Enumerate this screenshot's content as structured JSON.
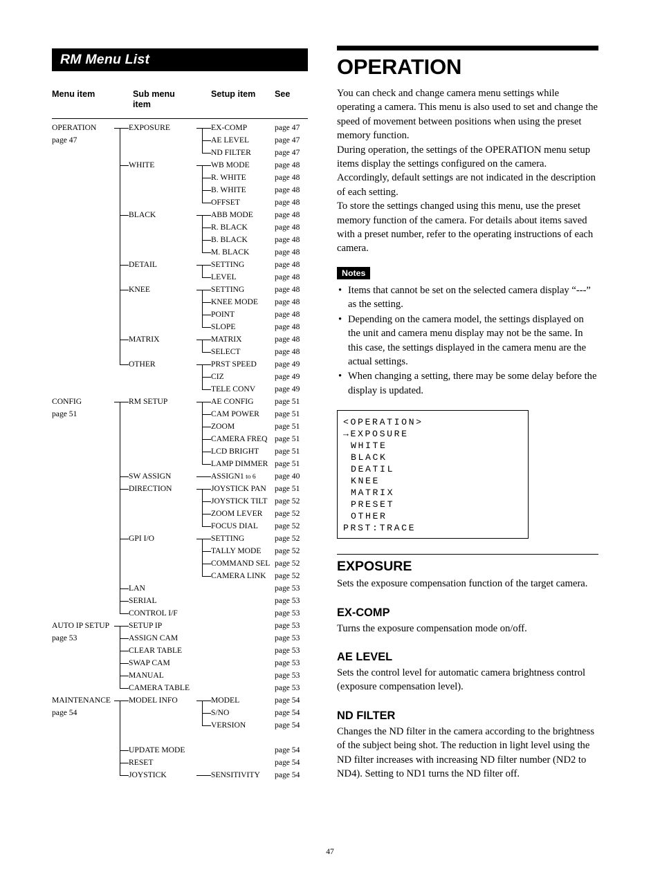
{
  "left": {
    "title": "RM Menu List",
    "columns": [
      "Menu item",
      "Sub menu item",
      "Setup item",
      "See"
    ],
    "column_headers": {
      "menu_item": "Menu item",
      "sub_menu_item_line1": "Sub menu",
      "sub_menu_item_line2": "item",
      "setup_item": "Setup item",
      "see": "See"
    },
    "rows": [
      {
        "l0": "OPERATION",
        "l1": "EXPOSURE",
        "l2": "EX-COMP",
        "see": "page 47",
        "l1conn": "top",
        "l2conn": "top"
      },
      {
        "l0": "page 47",
        "l1": "",
        "l2": "AE LEVEL",
        "see": "page 47",
        "l1conn": "mid",
        "l2conn": "mid"
      },
      {
        "l0": "",
        "l1": "",
        "l2": "ND FILTER",
        "see": "page 47",
        "l1conn": "mid",
        "l2conn": "end"
      },
      {
        "l0": "",
        "l1": "WHITE",
        "l2": "WB MODE",
        "see": "page 48",
        "l1conn": "tee",
        "l2conn": "top"
      },
      {
        "l0": "",
        "l1": "",
        "l2": "R. WHITE",
        "see": "page 48",
        "l1conn": "mid",
        "l2conn": "mid"
      },
      {
        "l0": "",
        "l1": "",
        "l2": "B. WHITE",
        "see": "page 48",
        "l1conn": "mid",
        "l2conn": "mid"
      },
      {
        "l0": "",
        "l1": "",
        "l2": "OFFSET",
        "see": "page 48",
        "l1conn": "mid",
        "l2conn": "end"
      },
      {
        "l0": "",
        "l1": "BLACK",
        "l2": "ABB MODE",
        "see": "page 48",
        "l1conn": "tee",
        "l2conn": "top"
      },
      {
        "l0": "",
        "l1": "",
        "l2": "R. BLACK",
        "see": "page 48",
        "l1conn": "mid",
        "l2conn": "mid"
      },
      {
        "l0": "",
        "l1": "",
        "l2": "B. BLACK",
        "see": "page 48",
        "l1conn": "mid",
        "l2conn": "mid"
      },
      {
        "l0": "",
        "l1": "",
        "l2": "M. BLACK",
        "see": "page 48",
        "l1conn": "mid",
        "l2conn": "end"
      },
      {
        "l0": "",
        "l1": "DETAIL",
        "l2": "SETTING",
        "see": "page 48",
        "l1conn": "tee",
        "l2conn": "top"
      },
      {
        "l0": "",
        "l1": "",
        "l2": "LEVEL",
        "see": "page 48",
        "l1conn": "mid",
        "l2conn": "end"
      },
      {
        "l0": "",
        "l1": "KNEE",
        "l2": "SETTING",
        "see": "page 48",
        "l1conn": "tee",
        "l2conn": "top"
      },
      {
        "l0": "",
        "l1": "",
        "l2": "KNEE MODE",
        "see": "page 48",
        "l1conn": "mid",
        "l2conn": "mid"
      },
      {
        "l0": "",
        "l1": "",
        "l2": "POINT",
        "see": "page 48",
        "l1conn": "mid",
        "l2conn": "mid"
      },
      {
        "l0": "",
        "l1": "",
        "l2": "SLOPE",
        "see": "page 48",
        "l1conn": "mid",
        "l2conn": "end"
      },
      {
        "l0": "",
        "l1": "MATRIX",
        "l2": "MATRIX",
        "see": "page 48",
        "l1conn": "tee",
        "l2conn": "top"
      },
      {
        "l0": "",
        "l1": "",
        "l2": "SELECT",
        "see": "page 48",
        "l1conn": "mid",
        "l2conn": "end"
      },
      {
        "l0": "",
        "l1": "OTHER",
        "l2": "PRST SPEED",
        "see": "page 49",
        "l1conn": "endtee",
        "l2conn": "top"
      },
      {
        "l0": "",
        "l1": "",
        "l2": "CIZ",
        "see": "page 49",
        "l1conn": "none",
        "l2conn": "mid"
      },
      {
        "l0": "",
        "l1": "",
        "l2": "TELE CONV",
        "see": "page 49",
        "l1conn": "none",
        "l2conn": "end"
      },
      {
        "l0": "CONFIG",
        "l1": "RM SETUP",
        "l2": "AE CONFIG",
        "see": "page 51",
        "l1conn": "top",
        "l2conn": "top"
      },
      {
        "l0": "page 51",
        "l1": "",
        "l2": "CAM POWER",
        "see": "page 51",
        "l1conn": "mid",
        "l2conn": "mid"
      },
      {
        "l0": "",
        "l1": "",
        "l2": "ZOOM",
        "see": "page 51",
        "l1conn": "mid",
        "l2conn": "mid"
      },
      {
        "l0": "",
        "l1": "",
        "l2": "CAMERA FREQ",
        "see": "page 51",
        "l1conn": "mid",
        "l2conn": "mid"
      },
      {
        "l0": "",
        "l1": "",
        "l2": "LCD BRIGHT",
        "see": "page 51",
        "l1conn": "mid",
        "l2conn": "mid"
      },
      {
        "l0": "",
        "l1": "",
        "l2": "LAMP DIMMER",
        "see": "page 51",
        "l1conn": "mid",
        "l2conn": "end"
      },
      {
        "l0": "",
        "l1": "SW ASSIGN",
        "l2": "ASSIGN1 to 6",
        "see": "page 40",
        "l1conn": "tee",
        "l2conn": "flat",
        "l2small": " to 6",
        "l2main": "ASSIGN1"
      },
      {
        "l0": "",
        "l1": "DIRECTION",
        "l2": "JOYSTICK PAN",
        "see": "page 51",
        "l1conn": "tee",
        "l2conn": "top"
      },
      {
        "l0": "",
        "l1": "",
        "l2": "JOYSTICK TILT",
        "see": "page 52",
        "l1conn": "mid",
        "l2conn": "mid"
      },
      {
        "l0": "",
        "l1": "",
        "l2": "ZOOM LEVER",
        "see": "page 52",
        "l1conn": "mid",
        "l2conn": "mid"
      },
      {
        "l0": "",
        "l1": "",
        "l2": "FOCUS DIAL",
        "see": "page 52",
        "l1conn": "mid",
        "l2conn": "end"
      },
      {
        "l0": "",
        "l1": "GPI I/O",
        "l2": "SETTING",
        "see": "page 52",
        "l1conn": "tee",
        "l2conn": "top"
      },
      {
        "l0": "",
        "l1": "",
        "l2": "TALLY MODE",
        "see": "page 52",
        "l1conn": "mid",
        "l2conn": "mid"
      },
      {
        "l0": "",
        "l1": "",
        "l2": "COMMAND SEL",
        "see": "page 52",
        "l1conn": "mid",
        "l2conn": "mid"
      },
      {
        "l0": "",
        "l1": "",
        "l2": "CAMERA LINK",
        "see": "page 52",
        "l1conn": "mid",
        "l2conn": "end"
      },
      {
        "l0": "",
        "l1": "LAN",
        "l2": "",
        "see": "page 53",
        "l1conn": "tee",
        "l2conn": "none"
      },
      {
        "l0": "",
        "l1": "SERIAL",
        "l2": "",
        "see": "page 53",
        "l1conn": "tee",
        "l2conn": "none"
      },
      {
        "l0": "",
        "l1": "CONTROL I/F",
        "l2": "",
        "see": "page 53",
        "l1conn": "endtee",
        "l2conn": "none"
      },
      {
        "l0": "AUTO IP SETUP",
        "l1": "SETUP IP",
        "l2": "",
        "see": "page 53",
        "l1conn": "top",
        "l2conn": "none"
      },
      {
        "l0": "page 53",
        "l1": "ASSIGN CAM",
        "l2": "",
        "see": "page 53",
        "l1conn": "tee",
        "l2conn": "none"
      },
      {
        "l0": "",
        "l1": "CLEAR TABLE",
        "l2": "",
        "see": "page 53",
        "l1conn": "tee",
        "l2conn": "none"
      },
      {
        "l0": "",
        "l1": "SWAP CAM",
        "l2": "",
        "see": "page 53",
        "l1conn": "tee",
        "l2conn": "none"
      },
      {
        "l0": "",
        "l1": "MANUAL",
        "l2": "",
        "see": "page 53",
        "l1conn": "tee",
        "l2conn": "none"
      },
      {
        "l0": "",
        "l1": "CAMERA TABLE",
        "l2": "",
        "see": "page 53",
        "l1conn": "endtee",
        "l2conn": "none"
      },
      {
        "l0": "MAINTENANCE",
        "l1": "MODEL INFO",
        "l2": "MODEL",
        "see": "page 54",
        "l1conn": "top",
        "l2conn": "top"
      },
      {
        "l0": "page 54",
        "l1": "",
        "l2": "S/NO",
        "see": "page 54",
        "l1conn": "mid",
        "l2conn": "mid"
      },
      {
        "l0": "",
        "l1": "",
        "l2": "VERSION",
        "see": "page 54",
        "l1conn": "mid",
        "l2conn": "end"
      },
      {
        "l0": "",
        "l1": "",
        "l2": "",
        "see": "",
        "l1conn": "mid",
        "l2conn": "none"
      },
      {
        "l0": "",
        "l1": "UPDATE MODE",
        "l2": "",
        "see": "page 54",
        "l1conn": "tee",
        "l2conn": "none"
      },
      {
        "l0": "",
        "l1": "RESET",
        "l2": "",
        "see": "page 54",
        "l1conn": "tee",
        "l2conn": "none"
      },
      {
        "l0": "",
        "l1": "JOYSTICK",
        "l2": "SENSITIVITY",
        "see": "page 54",
        "l1conn": "endtee",
        "l2conn": "flat"
      }
    ]
  },
  "right": {
    "title": "OPERATION",
    "intro": "You can check and change camera menu settings while operating a camera. This menu is also used to set and change the speed of movement between positions when using the preset memory function. During operation, the settings of the OPERATION menu setup items display the settings configured on the camera. Accordingly, default settings are not indicated in the description of each setting. To store the settings changed using this menu, use the preset memory function of the camera. For details about items saved with a preset number, refer to the operating instructions of each camera.",
    "intro_paragraphs": [
      "You can check and change camera menu settings while operating a camera. This menu is also used to set and change the speed of movement between positions when using the preset memory function.",
      "During operation, the settings of the OPERATION menu setup items display the settings configured on the camera.",
      "Accordingly, default settings are not indicated in the description of each setting.",
      "To store the settings changed using this menu, use the preset memory function of the camera. For details about items saved with a preset number, refer to the operating instructions of each camera."
    ],
    "notes_label": "Notes",
    "notes": [
      "Items that cannot be set on the selected camera display “---” as the setting.",
      "Depending on the camera model, the settings displayed on the unit and camera menu display may not be the same. In this case, the settings displayed in the camera menu are the actual settings.",
      "When changing a setting, there may be some delay before the display is updated."
    ],
    "lcd": {
      "header": "<OPERATION>",
      "cursor_line": "→EXPOSURE",
      "items": [
        "WHITE",
        "BLACK",
        "DEATIL",
        "KNEE",
        "MATRIX",
        "PRESET",
        "OTHER"
      ],
      "footer": "PRST:TRACE"
    },
    "sections": [
      {
        "heading": "EXPOSURE",
        "level": "h2",
        "body": "Sets the exposure compensation function of the target camera."
      },
      {
        "heading": "EX-COMP",
        "level": "h3",
        "body": "Turns the exposure compensation mode on/off."
      },
      {
        "heading": "AE LEVEL",
        "level": "h3",
        "body": "Sets the control level for automatic camera brightness control (exposure compensation level)."
      },
      {
        "heading": "ND FILTER",
        "level": "h3",
        "body": "Changes the ND filter in the camera according to the brightness of the subject being shot. The reduction in light level using the ND filter increases with increasing ND filter number (ND2 to ND4). Setting to ND1 turns the ND filter off."
      }
    ]
  },
  "footer": {
    "page_number": "47"
  }
}
